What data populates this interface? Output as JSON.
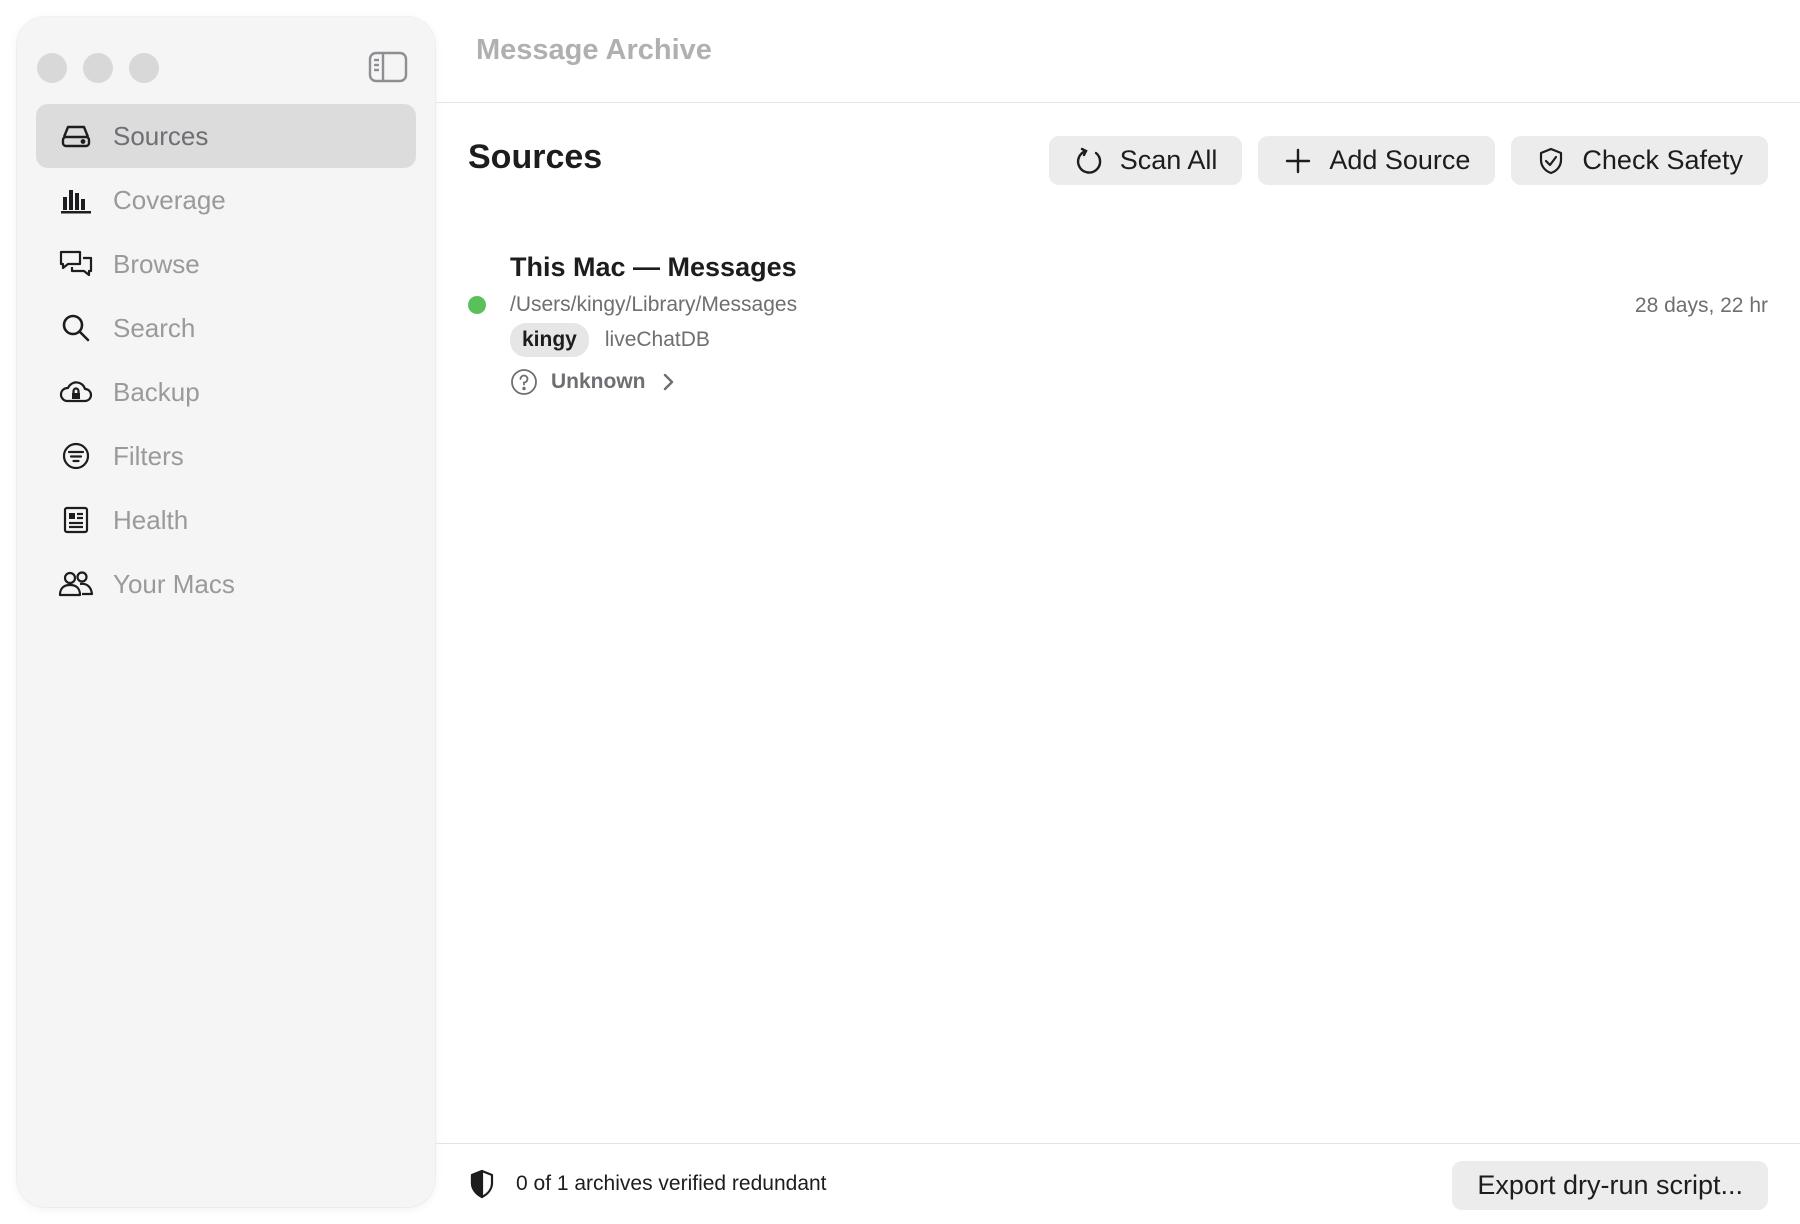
{
  "window": {
    "title": "Message Archive"
  },
  "sidebar": {
    "items": [
      {
        "label": "Sources",
        "icon": "drive-icon",
        "active": true
      },
      {
        "label": "Coverage",
        "icon": "bar-chart-icon"
      },
      {
        "label": "Browse",
        "icon": "chat-bubbles-icon"
      },
      {
        "label": "Search",
        "icon": "search-icon"
      },
      {
        "label": "Backup",
        "icon": "cloud-lock-icon"
      },
      {
        "label": "Filters",
        "icon": "filter-icon"
      },
      {
        "label": "Health",
        "icon": "health-card-icon"
      },
      {
        "label": "Your Macs",
        "icon": "people-icon"
      }
    ]
  },
  "main": {
    "heading": "Sources",
    "toolbar": {
      "scan_all": "Scan All",
      "add_source": "Add Source",
      "check_safety": "Check Safety"
    },
    "sources": [
      {
        "title": "This Mac — Messages",
        "path": "/Users/kingy/Library/Messages",
        "age": "28 days, 22 hr",
        "tag_user": "kingy",
        "tag_db": "liveChatDB",
        "status": "Unknown",
        "status_color": "#5ac05a"
      }
    ]
  },
  "footer": {
    "summary": "0 of 1 archives verified redundant",
    "export_label": "Export dry-run script..."
  },
  "colors": {
    "sidebar_bg": "#f5f5f5",
    "active_item_bg": "#dcdcdc",
    "button_bg": "#ececec"
  }
}
